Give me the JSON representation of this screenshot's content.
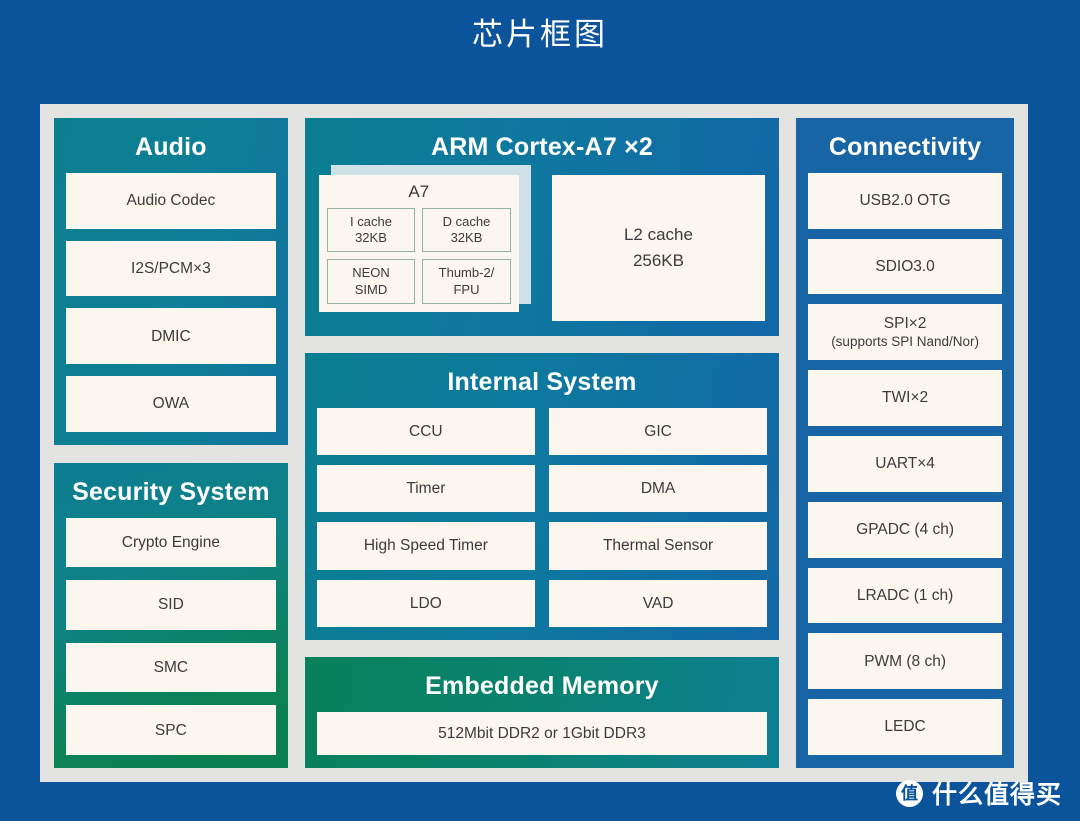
{
  "page": {
    "title": "芯片框图",
    "background_color": "#0b539b",
    "panel_color": "#e3e3e1"
  },
  "audio": {
    "title": "Audio",
    "accent": "#0e7f96",
    "items": [
      {
        "label": "Audio Codec"
      },
      {
        "label": "I2S/PCM×3"
      },
      {
        "label": "DMIC"
      },
      {
        "label": "OWA"
      }
    ]
  },
  "security": {
    "title": "Security System",
    "accent": "#0a8050",
    "items": [
      {
        "label": "Crypto Engine"
      },
      {
        "label": "SID"
      },
      {
        "label": "SMC"
      },
      {
        "label": "SPC"
      }
    ]
  },
  "arm": {
    "title": "ARM Cortex-A7 ×2",
    "accent": "#0f76a0",
    "core": {
      "label": "A7",
      "units": [
        {
          "line1": "I cache",
          "line2": "32KB"
        },
        {
          "line1": "D cache",
          "line2": "32KB"
        },
        {
          "line1": "NEON",
          "line2": "SIMD"
        },
        {
          "line1": "Thumb-2/",
          "line2": "FPU"
        }
      ]
    },
    "l2": {
      "line1": "L2 cache",
      "line2": "256KB"
    }
  },
  "internal": {
    "title": "Internal System",
    "accent": "#0e78a0",
    "items": [
      {
        "label": "CCU"
      },
      {
        "label": "GIC"
      },
      {
        "label": "Timer"
      },
      {
        "label": "DMA"
      },
      {
        "label": "High Speed Timer"
      },
      {
        "label": "Thermal Sensor"
      },
      {
        "label": "LDO"
      },
      {
        "label": "VAD"
      }
    ]
  },
  "memory": {
    "title": "Embedded Memory",
    "accent": "#09836e",
    "items": [
      {
        "label": "512Mbit DDR2 or 1Gbit DDR3"
      }
    ]
  },
  "connectivity": {
    "title": "Connectivity",
    "accent": "#1765a4",
    "items": [
      {
        "label": "USB2.0 OTG",
        "sub": ""
      },
      {
        "label": "SDIO3.0",
        "sub": ""
      },
      {
        "label": "SPI×2",
        "sub": "(supports SPI Nand/Nor)"
      },
      {
        "label": "TWI×2",
        "sub": ""
      },
      {
        "label": "UART×4",
        "sub": ""
      },
      {
        "label": "GPADC (4 ch)",
        "sub": ""
      },
      {
        "label": "LRADC (1 ch)",
        "sub": ""
      },
      {
        "label": "PWM (8 ch)",
        "sub": ""
      },
      {
        "label": "LEDC",
        "sub": ""
      }
    ]
  },
  "watermark": {
    "badge": "值",
    "text": "什么值得买"
  }
}
